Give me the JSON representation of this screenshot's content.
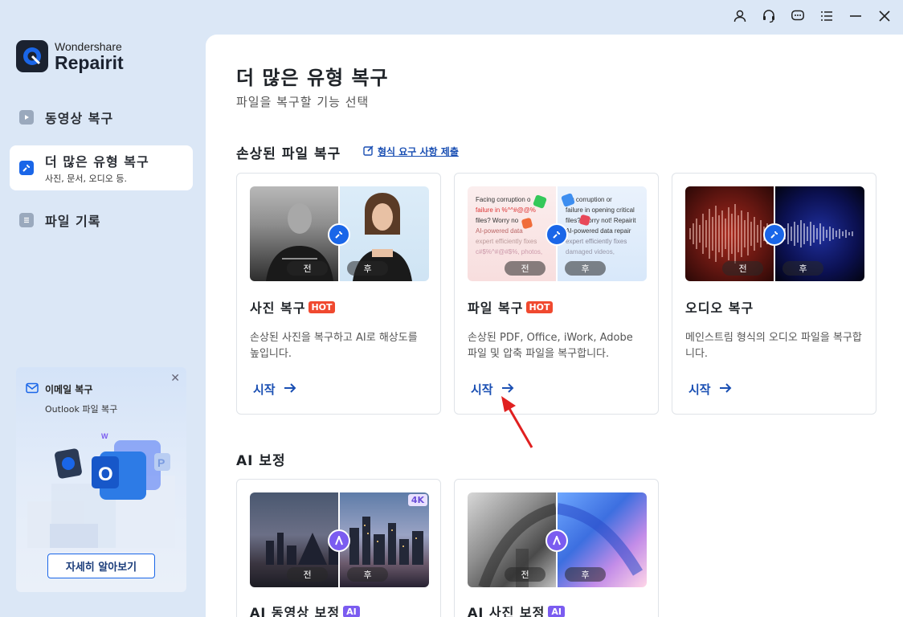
{
  "app": {
    "brand_top": "Wondershare",
    "brand_bottom": "Repairit",
    "accent": "#1a66e8"
  },
  "titlebar": {
    "icons": [
      "account-icon",
      "headset-icon",
      "chat-icon",
      "menu-icon",
      "minimize-icon",
      "close-icon"
    ]
  },
  "sidebar": {
    "items": [
      {
        "label": "동영상 복구",
        "sub": ""
      },
      {
        "label": "더 많은 유형 복구",
        "sub": "사진, 문서, 오디오 등."
      },
      {
        "label": "파일 기록",
        "sub": ""
      }
    ],
    "promo": {
      "title": "이메일 복구",
      "subtitle": "Outlook 파일 복구",
      "button": "자세히 알아보기"
    }
  },
  "main": {
    "title": "더 많은 유형 복구",
    "subtitle": "파일을 복구할 기능 선택",
    "section1": {
      "title": "손상된 파일 복구",
      "link": "형식 요구 사항 제출"
    },
    "section2": {
      "title": "AI 보정"
    },
    "before_label": "전",
    "after_label": "후",
    "start_label": "시작",
    "hot_label": "HOT",
    "ai_label": "AI",
    "k4_label": "4K",
    "cards": [
      {
        "title": "사진 복구",
        "desc": "손상된 사진을 복구하고 AI로 해상도를 높입니다."
      },
      {
        "title": "파일 복구",
        "desc": "손상된 PDF, Office, iWork, Adobe 파일 및 압축 파일을 복구합니다."
      },
      {
        "title": "오디오 복구",
        "desc": "메인스트림 형식의 오디오 파일을 복구합니다."
      },
      {
        "title": "AI 동영상 보정"
      },
      {
        "title": "AI 사진 보정"
      }
    ],
    "doc_preview": {
      "left": [
        "Facing corruption o",
        "failure in %^^#@@%",
        "files? Worry no",
        "AI-powered data",
        "expert efficiently fixes",
        "c#$%^#@#$%, photos,"
      ],
      "right": [
        "ing corruption or",
        "failure in opening critical",
        "files? Worry not! Repairit",
        "AI-powered data repair",
        "expert efficiently fixes",
        "damaged videos,"
      ]
    }
  }
}
